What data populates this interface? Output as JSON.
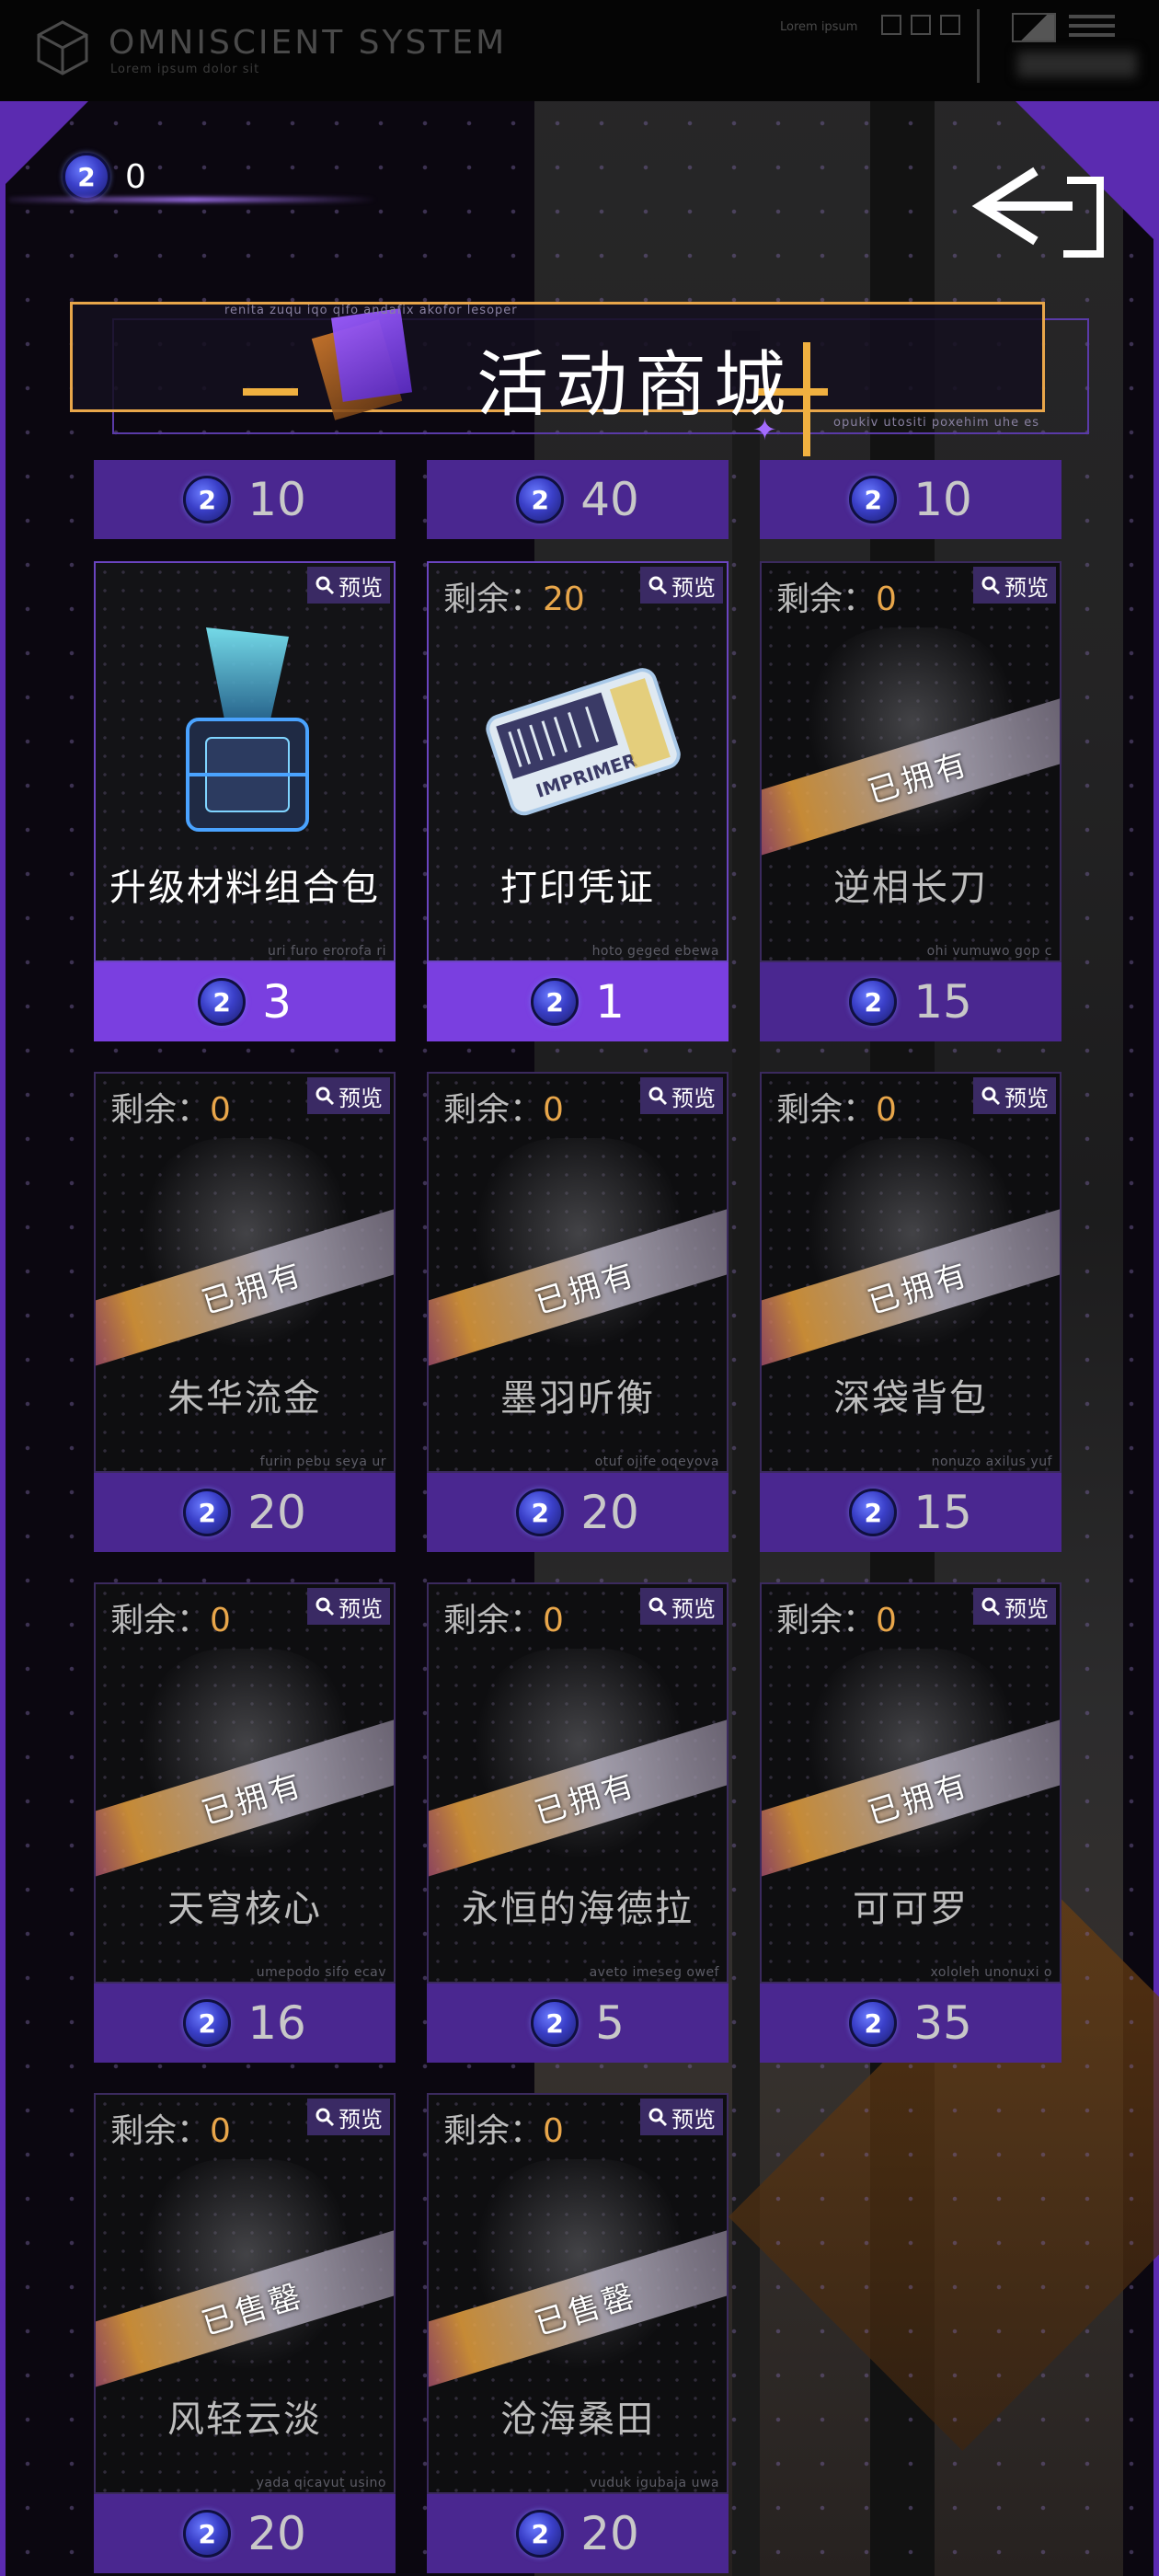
{
  "system": {
    "title": "OMNISCIENT SYSTEM",
    "subtitle": "Lorem ipsum dolor sit",
    "top_right_label": "Lorem ipsum"
  },
  "balance": {
    "value": "0",
    "icon": "coin-icon"
  },
  "banner": {
    "title": "活动商城",
    "tag_left": "renita zuqu iqo qifo andafix akofor lesoper",
    "tag_right": "opukiv utositi poxehim uhe es"
  },
  "colors": {
    "accent": "#7a3fe0",
    "frame": "#5b2bb0",
    "highlight": "#e8a64a"
  },
  "top_prices": [
    {
      "price": "10"
    },
    {
      "price": "40"
    },
    {
      "price": "10"
    }
  ],
  "labels": {
    "remain": "剩余：",
    "preview": "预览"
  },
  "items": [
    {
      "name": "升级材料组合包",
      "remain": "",
      "price": "3",
      "status": "",
      "code": "uri furo erorofa ri",
      "active": true,
      "icon": "crate-icon"
    },
    {
      "name": "打印凭证",
      "remain": "20",
      "price": "1",
      "status": "",
      "code": "hoto geged ebewa",
      "active": true,
      "icon": "ticket-icon"
    },
    {
      "name": "逆相长刀",
      "remain": "0",
      "price": "15",
      "status": "已拥有",
      "code": "ohi vumuwo gop c",
      "active": false
    },
    {
      "name": "朱华流金",
      "remain": "0",
      "price": "20",
      "status": "已拥有",
      "code": "furin pebu seya ur",
      "active": false
    },
    {
      "name": "墨羽听衡",
      "remain": "0",
      "price": "20",
      "status": "已拥有",
      "code": "otuf ojife oqeyova",
      "active": false
    },
    {
      "name": "深袋背包",
      "remain": "0",
      "price": "15",
      "status": "已拥有",
      "code": "nonuzo axilus yuf",
      "active": false
    },
    {
      "name": "天穹核心",
      "remain": "0",
      "price": "16",
      "status": "已拥有",
      "code": "umepodo sifo ecav",
      "active": false
    },
    {
      "name": "永恒的海德拉",
      "remain": "0",
      "price": "5",
      "status": "已拥有",
      "code": "aveto imeseg owef",
      "active": false
    },
    {
      "name": "可可罗",
      "remain": "0",
      "price": "35",
      "status": "已拥有",
      "code": "xololeh unonuxi o",
      "active": false
    },
    {
      "name": "风轻云淡",
      "remain": "0",
      "price": "20",
      "status": "已售罄",
      "code": "yada qicavut usino",
      "active": false
    },
    {
      "name": "沧海桑田",
      "remain": "0",
      "price": "20",
      "status": "已售罄",
      "code": "vuduk igubaja uwa",
      "active": false
    }
  ]
}
